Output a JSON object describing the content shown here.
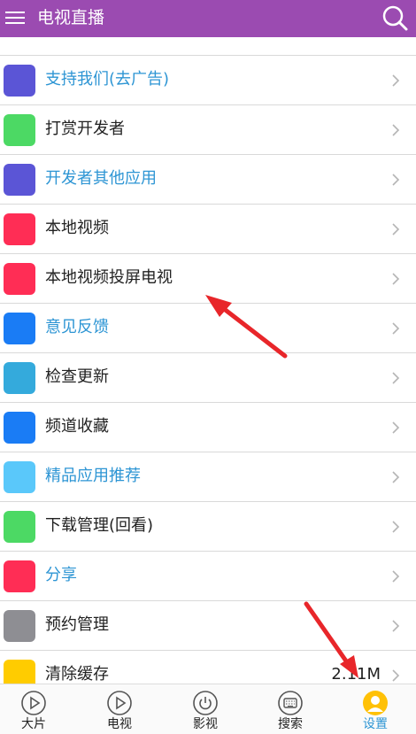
{
  "header": {
    "title": "电视直播",
    "menu_icon": "hamburger-menu-icon",
    "search_icon": "search-icon"
  },
  "settings": {
    "items": [
      {
        "label": "支持我们(去广告)",
        "color": "#5b55d6",
        "link": true
      },
      {
        "label": "打赏开发者",
        "color": "#4cd964",
        "link": false
      },
      {
        "label": "开发者其他应用",
        "color": "#5b55d6",
        "link": true
      },
      {
        "label": "本地视频",
        "color": "#ff2d55",
        "link": false
      },
      {
        "label": "本地视频投屏电视",
        "color": "#ff2d55",
        "link": false
      },
      {
        "label": "意见反馈",
        "color": "#1a7cf5",
        "link": true
      },
      {
        "label": "检查更新",
        "color": "#34aadc",
        "link": false
      },
      {
        "label": "频道收藏",
        "color": "#1a7cf5",
        "link": false
      },
      {
        "label": "精品应用推荐",
        "color": "#5ac8fa",
        "link": true
      },
      {
        "label": "下载管理(回看)",
        "color": "#4cd964",
        "link": false
      },
      {
        "label": "分享",
        "color": "#ff2d55",
        "link": true
      },
      {
        "label": "预约管理",
        "color": "#8e8e93",
        "link": false
      },
      {
        "label": "清除缓存",
        "color": "#ffcc00",
        "link": false,
        "value": "2.11M"
      }
    ]
  },
  "tabs": [
    {
      "label": "大片",
      "icon": "play-icon"
    },
    {
      "label": "电视",
      "icon": "play-icon"
    },
    {
      "label": "影视",
      "icon": "power-icon"
    },
    {
      "label": "搜索",
      "icon": "keyboard-icon"
    },
    {
      "label": "设置",
      "icon": "user-avatar-icon",
      "active": true
    }
  ],
  "colors": {
    "header_bg": "#9b4bb1",
    "accent": "#2d95d4",
    "annotation_arrow": "#e8262a"
  }
}
